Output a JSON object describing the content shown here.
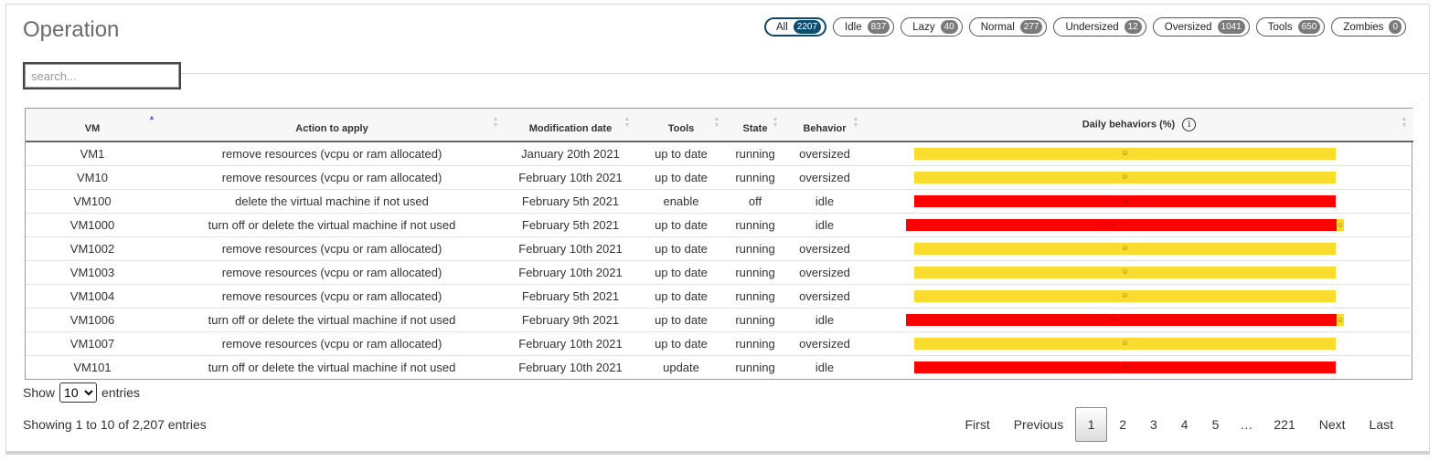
{
  "page": {
    "title": "Operation"
  },
  "filters": [
    {
      "label": "All",
      "count": "2207",
      "active": true
    },
    {
      "label": "Idle",
      "count": "837"
    },
    {
      "label": "Lazy",
      "count": "40"
    },
    {
      "label": "Normal",
      "count": "277"
    },
    {
      "label": "Undersized",
      "count": "12"
    },
    {
      "label": "Oversized",
      "count": "1041"
    },
    {
      "label": "Tools",
      "count": "650"
    },
    {
      "label": "Zombies",
      "count": "0"
    }
  ],
  "search": {
    "placeholder": "search...",
    "value": ""
  },
  "table": {
    "headers": {
      "vm": "VM",
      "action": "Action to apply",
      "modification": "Modification date",
      "tools": "Tools",
      "state": "State",
      "behavior": "Behavior",
      "daily": "Daily behaviors (%)"
    },
    "info_icon_glyph": "i",
    "bar_emoji_glyph": "☺",
    "rows": [
      {
        "vm": "VM1",
        "action": "remove resources (vcpu or ram allocated)",
        "date": "January 20th 2021",
        "tools": "up to date",
        "state": "running",
        "behavior": "oversized",
        "bar_color": "yellow",
        "bar_pct": 100,
        "extra": false
      },
      {
        "vm": "VM10",
        "action": "remove resources (vcpu or ram allocated)",
        "date": "February 10th 2021",
        "tools": "up to date",
        "state": "running",
        "behavior": "oversized",
        "bar_color": "yellow",
        "bar_pct": 100,
        "extra": false
      },
      {
        "vm": "VM100",
        "action": "delete the virtual machine if not used",
        "date": "February 5th 2021",
        "tools": "enable",
        "state": "off",
        "behavior": "idle",
        "bar_color": "red",
        "bar_pct": 100,
        "extra": false
      },
      {
        "vm": "VM1000",
        "action": "turn off or delete the virtual machine if not used",
        "date": "February 5th 2021",
        "tools": "up to date",
        "state": "running",
        "behavior": "idle",
        "bar_color": "red",
        "bar_pct": 98,
        "extra": true
      },
      {
        "vm": "VM1002",
        "action": "remove resources (vcpu or ram allocated)",
        "date": "February 10th 2021",
        "tools": "up to date",
        "state": "running",
        "behavior": "oversized",
        "bar_color": "yellow",
        "bar_pct": 100,
        "extra": false
      },
      {
        "vm": "VM1003",
        "action": "remove resources (vcpu or ram allocated)",
        "date": "February 10th 2021",
        "tools": "up to date",
        "state": "running",
        "behavior": "oversized",
        "bar_color": "yellow",
        "bar_pct": 100,
        "extra": false
      },
      {
        "vm": "VM1004",
        "action": "remove resources (vcpu or ram allocated)",
        "date": "February 5th 2021",
        "tools": "up to date",
        "state": "running",
        "behavior": "oversized",
        "bar_color": "yellow",
        "bar_pct": 100,
        "extra": false
      },
      {
        "vm": "VM1006",
        "action": "turn off or delete the virtual machine if not used",
        "date": "February 9th 2021",
        "tools": "up to date",
        "state": "running",
        "behavior": "idle",
        "bar_color": "red",
        "bar_pct": 98,
        "extra": true
      },
      {
        "vm": "VM1007",
        "action": "remove resources (vcpu or ram allocated)",
        "date": "February 10th 2021",
        "tools": "up to date",
        "state": "running",
        "behavior": "oversized",
        "bar_color": "yellow",
        "bar_pct": 100,
        "extra": false
      },
      {
        "vm": "VM101",
        "action": "turn off or delete the virtual machine if not used",
        "date": "February 10th 2021",
        "tools": "update",
        "state": "running",
        "behavior": "idle",
        "bar_color": "red",
        "bar_pct": 100,
        "extra": false
      }
    ]
  },
  "length_menu": {
    "prefix": "Show",
    "selected": "10",
    "suffix": "entries"
  },
  "info": "Showing 1 to 10 of 2,207 entries",
  "pagination": {
    "first": "First",
    "previous": "Previous",
    "pages": [
      "1",
      "2",
      "3",
      "4",
      "5"
    ],
    "ellipsis": "…",
    "last_page": "221",
    "next": "Next",
    "last": "Last",
    "current": "1"
  },
  "colors": {
    "yellow": "#f9dc2e",
    "red": "#ff0000",
    "active_badge": "#0e4d70"
  }
}
